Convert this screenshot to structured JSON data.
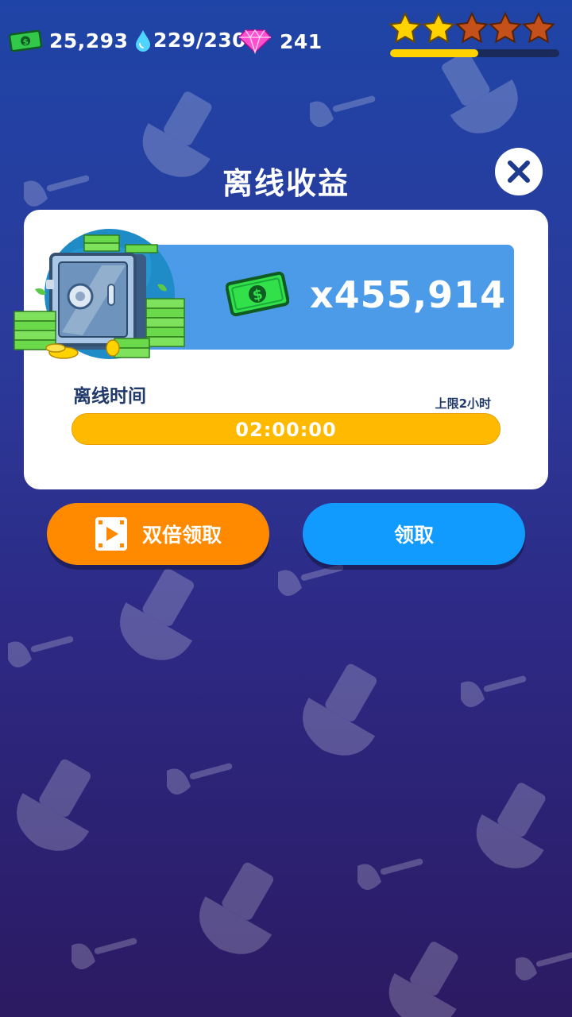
{
  "hud": {
    "cash": "25,293",
    "energy": "229/230",
    "gems": "241",
    "stars_filled": 2,
    "stars_total": 5,
    "star_progress": 0.52
  },
  "popup": {
    "title": "离线收益",
    "reward_amount": "x455,914",
    "offline_time_label": "离线时间",
    "limit_label": "上限2小时",
    "offline_time": "02:00:00",
    "double_button": "双倍领取",
    "claim_button": "领取"
  },
  "colors": {
    "panel_bg": "#ffffff",
    "reward_box": "#4c9be8",
    "time_bar": "#ffba00",
    "double_button": "#ff8a00",
    "claim_button": "#119bff",
    "star_filled": "#ffd200",
    "star_empty": "#c4511c"
  },
  "icons": {
    "cash": "cash-icon",
    "energy": "water-drop-icon",
    "gems": "gem-icon",
    "close": "close-icon",
    "video": "video-icon",
    "safe": "safe-icon"
  }
}
